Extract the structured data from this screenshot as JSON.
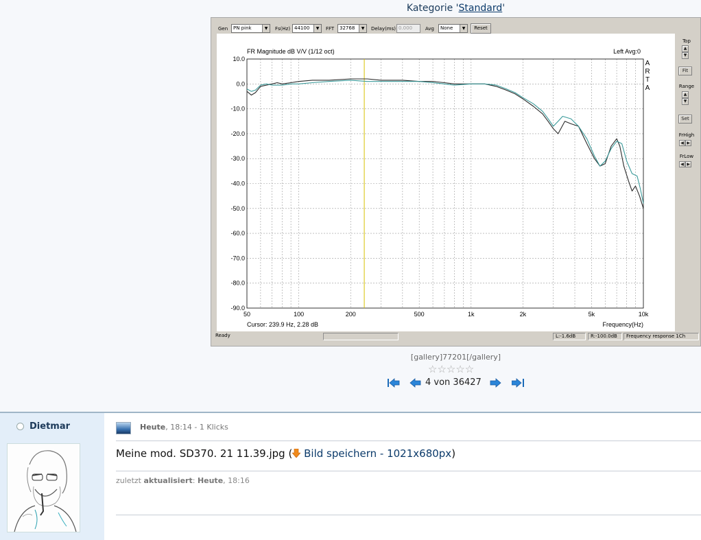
{
  "category": {
    "prefix": "Kategorie '",
    "link": "Standard",
    "suffix": "'"
  },
  "arta": {
    "toolbar": {
      "gen_label": "Gen",
      "gen_value": "PN pink",
      "fs_label": "Fs(Hz)",
      "fs_value": "44100",
      "fft_label": "FFT",
      "fft_value": "32768",
      "delay_label": "Delay(ms)",
      "delay_value": "0.000",
      "avg_label": "Avg",
      "avg_value": "None",
      "reset_label": "Reset"
    },
    "right_panel": {
      "top_label": "Top",
      "fit_label": "Fit",
      "range_label": "Range",
      "set_label": "Set",
      "frhigh_label": "FrHigh",
      "frlow_label": "FrLow"
    },
    "status": {
      "ready": "Ready",
      "l": "L:-1.6dB",
      "r": "R:-100.0dB",
      "mode": "Frequency response 1Ch"
    }
  },
  "chart_data": {
    "type": "line",
    "title": "FR Magnitude dB V/V (1/12 oct)",
    "header_right": "Left  Avg:0",
    "watermark": "ARTA",
    "xlabel": "Frequency(Hz)",
    "ylabel": "",
    "x_scale": "log",
    "xlim": [
      50,
      10000
    ],
    "ylim": [
      -90,
      10
    ],
    "x_ticks": [
      {
        "v": 50,
        "label": "50"
      },
      {
        "v": 100,
        "label": "100"
      },
      {
        "v": 200,
        "label": "200"
      },
      {
        "v": 500,
        "label": "500"
      },
      {
        "v": 1000,
        "label": "1k"
      },
      {
        "v": 2000,
        "label": "2k"
      },
      {
        "v": 5000,
        "label": "5k"
      },
      {
        "v": 10000,
        "label": "10k"
      }
    ],
    "y_ticks": [
      {
        "v": 10,
        "label": "10.0"
      },
      {
        "v": 0,
        "label": "0.0"
      },
      {
        "v": -10,
        "label": "-10.0"
      },
      {
        "v": -20,
        "label": "-20.0"
      },
      {
        "v": -30,
        "label": "-30.0"
      },
      {
        "v": -40,
        "label": "-40.0"
      },
      {
        "v": -50,
        "label": "-50.0"
      },
      {
        "v": -60,
        "label": "-60.0"
      },
      {
        "v": -70,
        "label": "-70.0"
      },
      {
        "v": -80,
        "label": "-80.0"
      },
      {
        "v": -90,
        "label": "-90.0"
      }
    ],
    "grid": true,
    "cursor": {
      "x": 239.9,
      "label": "Cursor:   239.9 Hz, 2.28 dB",
      "color": "#d8c000"
    },
    "series": [
      {
        "color": "#2a2a2a",
        "points": [
          [
            50,
            -3
          ],
          [
            53,
            -4.5
          ],
          [
            56,
            -3.5
          ],
          [
            60,
            -1
          ],
          [
            65,
            -0.5
          ],
          [
            70,
            0
          ],
          [
            75,
            0.5
          ],
          [
            80,
            0
          ],
          [
            90,
            0.5
          ],
          [
            100,
            1
          ],
          [
            120,
            1.5
          ],
          [
            150,
            1.5
          ],
          [
            200,
            2
          ],
          [
            250,
            2
          ],
          [
            300,
            1.5
          ],
          [
            400,
            1.5
          ],
          [
            500,
            1
          ],
          [
            600,
            1
          ],
          [
            700,
            0.5
          ],
          [
            800,
            0
          ],
          [
            1000,
            0
          ],
          [
            1200,
            0
          ],
          [
            1400,
            -1
          ],
          [
            1600,
            -2.5
          ],
          [
            1800,
            -4
          ],
          [
            2000,
            -6
          ],
          [
            2300,
            -9
          ],
          [
            2600,
            -12
          ],
          [
            2800,
            -15
          ],
          [
            3000,
            -18
          ],
          [
            3200,
            -20
          ],
          [
            3500,
            -15
          ],
          [
            3800,
            -16
          ],
          [
            4200,
            -17
          ],
          [
            4700,
            -24
          ],
          [
            5200,
            -30
          ],
          [
            5600,
            -33
          ],
          [
            6000,
            -32
          ],
          [
            6500,
            -25
          ],
          [
            7000,
            -22
          ],
          [
            7300,
            -25
          ],
          [
            7700,
            -33
          ],
          [
            8200,
            -39
          ],
          [
            8600,
            -43
          ],
          [
            9000,
            -41
          ],
          [
            9500,
            -45
          ],
          [
            10000,
            -50
          ]
        ]
      },
      {
        "color": "#3a9a9a",
        "points": [
          [
            50,
            -2
          ],
          [
            53,
            -3
          ],
          [
            56,
            -2.5
          ],
          [
            60,
            -0.5
          ],
          [
            65,
            0
          ],
          [
            70,
            -0.5
          ],
          [
            80,
            -0.5
          ],
          [
            90,
            0
          ],
          [
            100,
            0
          ],
          [
            120,
            0.5
          ],
          [
            150,
            1
          ],
          [
            200,
            1.5
          ],
          [
            250,
            1
          ],
          [
            300,
            1
          ],
          [
            400,
            1
          ],
          [
            500,
            1
          ],
          [
            600,
            0.5
          ],
          [
            700,
            0
          ],
          [
            800,
            -0.5
          ],
          [
            1000,
            0
          ],
          [
            1200,
            0
          ],
          [
            1400,
            -0.5
          ],
          [
            1600,
            -2
          ],
          [
            1800,
            -3.5
          ],
          [
            2000,
            -5.5
          ],
          [
            2300,
            -8
          ],
          [
            2600,
            -11
          ],
          [
            2800,
            -14
          ],
          [
            3000,
            -17
          ],
          [
            3200,
            -15
          ],
          [
            3400,
            -13
          ],
          [
            3800,
            -14
          ],
          [
            4200,
            -17
          ],
          [
            4700,
            -22
          ],
          [
            5200,
            -29
          ],
          [
            5600,
            -33
          ],
          [
            6000,
            -31
          ],
          [
            6500,
            -26
          ],
          [
            7000,
            -23
          ],
          [
            7500,
            -24
          ],
          [
            8000,
            -31
          ],
          [
            8600,
            -36
          ],
          [
            9200,
            -37
          ],
          [
            9600,
            -42
          ],
          [
            10000,
            -48
          ]
        ]
      }
    ]
  },
  "gallery": {
    "caption": "[gallery]77201[/gallery]",
    "stars": "☆☆☆☆☆",
    "pager_text": "4 von 36427"
  },
  "post": {
    "username": "Dietmar",
    "meta_time": "Heute",
    "meta_rest": ", 18:14 - 1 Klicks",
    "title": "Meine mod. SD370. 21 11.39.jpg (",
    "download": "Bild speichern - 1021x680px",
    "title_close": ")",
    "updated_prefix": "zuletzt ",
    "updated_word": "aktualisiert",
    "updated_colon": ": ",
    "updated_day": "Heute",
    "updated_time": ", 18:16"
  }
}
